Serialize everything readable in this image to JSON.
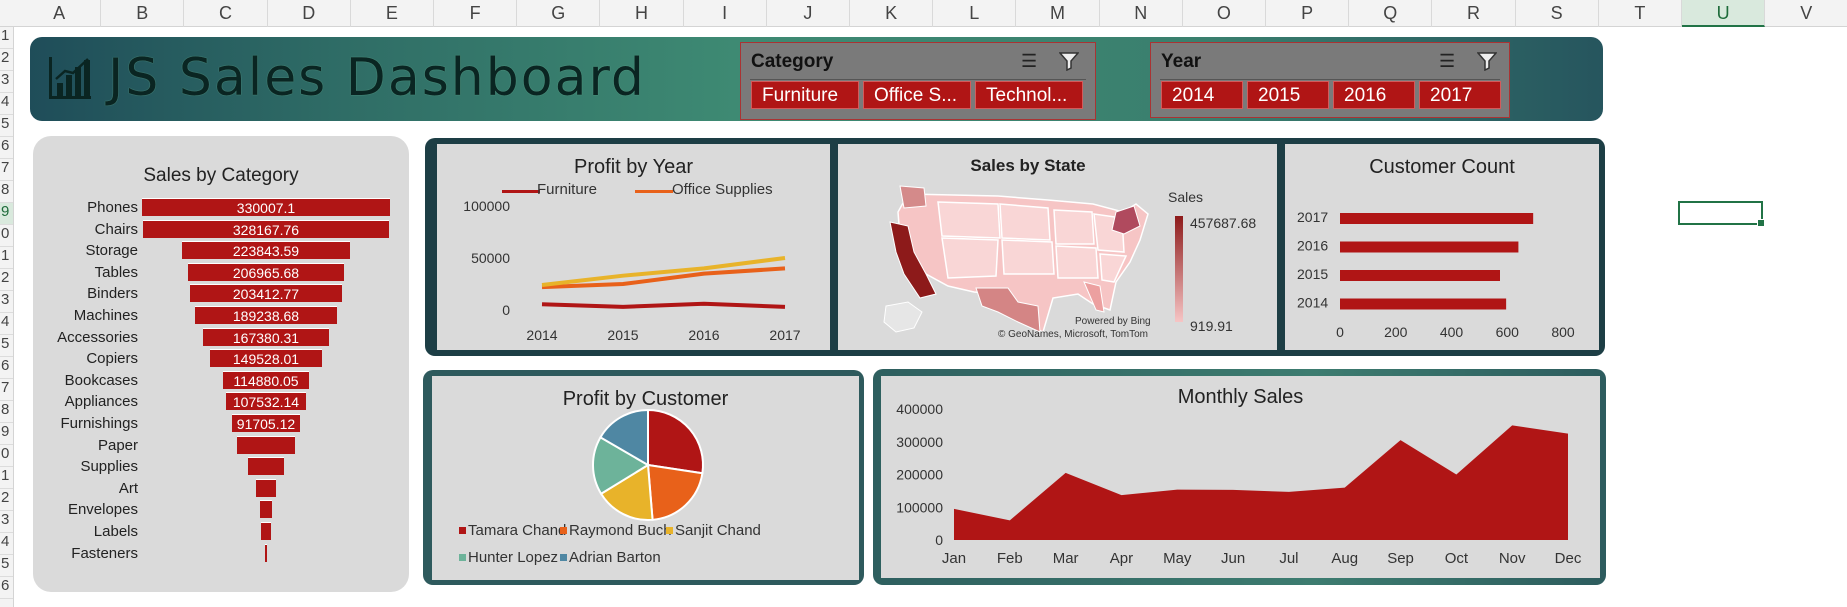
{
  "sheet": {
    "columns": [
      "A",
      "B",
      "C",
      "D",
      "E",
      "F",
      "G",
      "H",
      "I",
      "J",
      "K",
      "L",
      "M",
      "N",
      "O",
      "P",
      "Q",
      "R",
      "S",
      "T",
      "U",
      "V"
    ],
    "rows": [
      "1",
      "2",
      "3",
      "4",
      "5",
      "6",
      "7",
      "8",
      "9",
      "0",
      "1",
      "2",
      "3",
      "4",
      "5",
      "6",
      "7",
      "8",
      "9",
      "0",
      "1",
      "2",
      "3",
      "4",
      "5",
      "6"
    ],
    "selected_column": "U",
    "selected_row_index": 8
  },
  "header": {
    "title": "JS Sales Dashboard",
    "logo_icon": "bar-chart-icon"
  },
  "slicers": {
    "category": {
      "title": "Category",
      "items": [
        "Furniture",
        "Office S...",
        "Technol..."
      ]
    },
    "year": {
      "title": "Year",
      "items": [
        "2014",
        "2015",
        "2016",
        "2017"
      ]
    }
  },
  "colors": {
    "accent": "#b01515",
    "orange": "#e8611a",
    "yellow": "#e8b32a",
    "teal": "#6db39a",
    "blue": "#4f87a3"
  },
  "charts": {
    "sales_by_category": {
      "title": "Sales by Category",
      "chart_data": {
        "type": "bar",
        "categories": [
          "Phones",
          "Chairs",
          "Storage",
          "Tables",
          "Binders",
          "Machines",
          "Accessories",
          "Copiers",
          "Bookcases",
          "Appliances",
          "Furnishings",
          "Paper",
          "Supplies",
          "Art",
          "Envelopes",
          "Labels",
          "Fasteners"
        ],
        "values": [
          330007.1,
          328167.76,
          223843.59,
          206965.68,
          203412.77,
          189238.68,
          167380.31,
          149528.01,
          114880.05,
          107532.14,
          91705.12,
          78479,
          46674,
          27119,
          16476,
          12486,
          3024
        ],
        "data_labels": [
          "330007.1",
          "328167.76",
          "223843.59",
          "206965.68",
          "203412.77",
          "189238.68",
          "167380.31",
          "149528.01",
          "114880.05",
          "107532.14",
          "91705.12",
          "",
          "",
          "",
          "",
          "",
          ""
        ]
      }
    },
    "profit_by_year": {
      "title": "Profit by Year",
      "legend": [
        "Furniture",
        "Office Supplies"
      ],
      "chart_data": {
        "type": "line",
        "x": [
          "2014",
          "2015",
          "2016",
          "2017"
        ],
        "ylim": [
          0,
          100000
        ],
        "yticks": [
          "100000",
          "50000",
          "0"
        ],
        "series": [
          {
            "name": "Furniture",
            "values": [
              5500,
              3000,
              6000,
              3000
            ],
            "color": "#b01515"
          },
          {
            "name": "Office Supplies",
            "values": [
              22000,
              25000,
              35000,
              40000
            ],
            "color": "#e8611a"
          },
          {
            "name": "",
            "values": [
              24000,
              33000,
              40000,
              50000
            ],
            "color": "#e8b32a"
          }
        ]
      }
    },
    "sales_by_state": {
      "title": "Sales by State",
      "legend_title": "Sales",
      "max_label": "457687.68",
      "min_label": "919.91",
      "credit1": "Powered by Bing",
      "credit2": "© GeoNames, Microsoft, TomTom"
    },
    "customer_count": {
      "title": "Customer Count",
      "chart_data": {
        "type": "bar",
        "categories": [
          "2017",
          "2016",
          "2015",
          "2014"
        ],
        "values": [
          693,
          640,
          574,
          596
        ],
        "xlim": [
          0,
          800
        ],
        "xticks": [
          "0",
          "200",
          "400",
          "600",
          "800"
        ]
      }
    },
    "profit_by_customer": {
      "title": "Profit by Customer",
      "chart_data": {
        "type": "pie",
        "labels": [
          "Tamara Chand",
          "Raymond Buch",
          "Sanjit Chand",
          "Hunter Lopez",
          "Adrian Barton"
        ],
        "values": [
          8981,
          6976,
          5757,
          5622,
          5444
        ],
        "colors": [
          "#b01515",
          "#e8611a",
          "#e8b32a",
          "#6db39a",
          "#4f87a3"
        ]
      }
    },
    "monthly_sales": {
      "title": "Monthly Sales",
      "chart_data": {
        "type": "area",
        "x": [
          "Jan",
          "Feb",
          "Mar",
          "Apr",
          "May",
          "Jun",
          "Jul",
          "Aug",
          "Sep",
          "Oct",
          "Nov",
          "Dec"
        ],
        "values": [
          95000,
          60000,
          205000,
          137000,
          154000,
          153000,
          147000,
          160000,
          305000,
          200000,
          350000,
          325000
        ],
        "ylim": [
          0,
          400000
        ],
        "yticks": [
          "400000",
          "300000",
          "200000",
          "100000",
          "0"
        ]
      }
    }
  }
}
